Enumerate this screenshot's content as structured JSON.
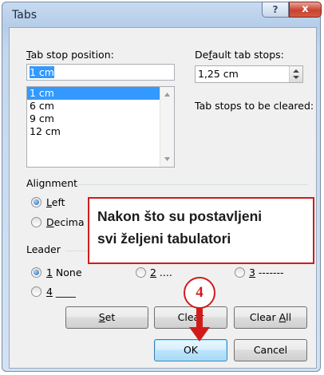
{
  "window": {
    "title": "Tabs",
    "help_glyph": "?",
    "close_glyph": "x"
  },
  "tab_stop_position": {
    "label_prefix": "",
    "label_underlined": "T",
    "label_rest": "ab stop position:",
    "value": "1 cm",
    "list_items": [
      "1 cm",
      "6 cm",
      "9 cm",
      "12 cm"
    ],
    "selected_index": 0
  },
  "default_tab_stops": {
    "label_prefix": "De",
    "label_underlined": "f",
    "label_rest": "ault tab stops:",
    "value": "1,25 cm"
  },
  "tab_stops_to_be_cleared": {
    "label": "Tab stops to be cleared:"
  },
  "alignment": {
    "title": "Alignment",
    "left": {
      "underlined": "L",
      "rest": "eft",
      "checked": true
    },
    "decimal": {
      "prefix": "",
      "underlined": "D",
      "rest": "ecima",
      "checked": false
    }
  },
  "leader": {
    "title": "Leader",
    "none": {
      "underlined": "1",
      "rest": " None",
      "checked": true
    },
    "dots": {
      "underlined": "2",
      "rest": " ....",
      "checked": false
    },
    "dashes": {
      "underlined": "3",
      "rest": " -------",
      "checked": false
    },
    "underline": {
      "underlined": "4",
      "rest": " ____",
      "checked": false
    }
  },
  "buttons": {
    "set": {
      "underlined": "S",
      "rest": "et"
    },
    "clear": {
      "label": "Clear"
    },
    "clear_all": {
      "prefix": "Clear ",
      "underlined": "A",
      "rest": "ll"
    },
    "ok": "OK",
    "cancel": "Cancel"
  },
  "annotation": {
    "line1": "Nakon što su postavljeni",
    "line2": "svi željeni tabulatori",
    "step_number": "4",
    "color": "#d11b1b"
  }
}
